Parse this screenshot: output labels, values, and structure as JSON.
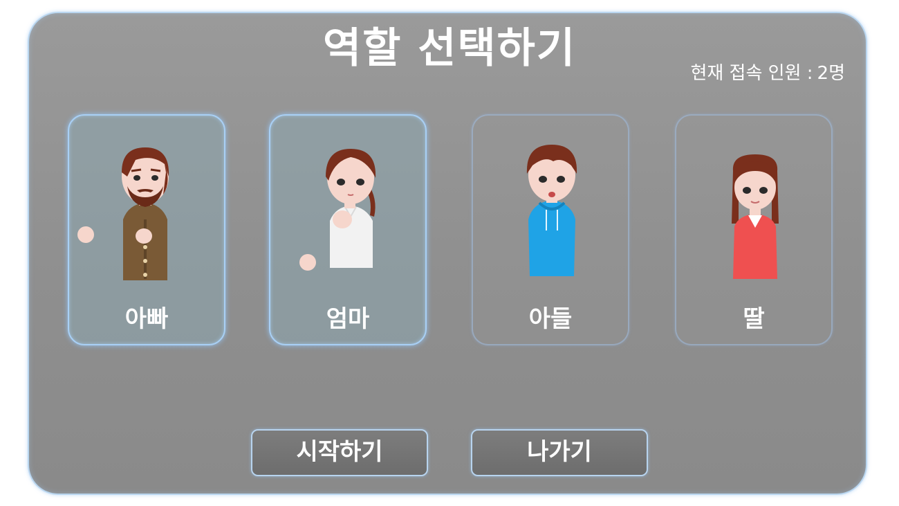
{
  "title": "역할 선택하기",
  "online": {
    "label": "현재 접속 인원 :",
    "count": "2명"
  },
  "roles": [
    {
      "label": "아빠",
      "selected": true
    },
    {
      "label": "엄마",
      "selected": true
    },
    {
      "label": "아들",
      "selected": false
    },
    {
      "label": "딸",
      "selected": false
    }
  ],
  "buttons": {
    "start": "시작하기",
    "exit": "나가기"
  },
  "colors": {
    "panel": "#919191",
    "glow": "#a9d0f5",
    "dad_shirt": "#7a5a36",
    "mom_shirt": "#f2f2f2",
    "son_hoodie": "#1fa3e6",
    "daughter_top": "#ef5050",
    "hair": "#7a2f1c",
    "skin": "#f6d6cc"
  }
}
